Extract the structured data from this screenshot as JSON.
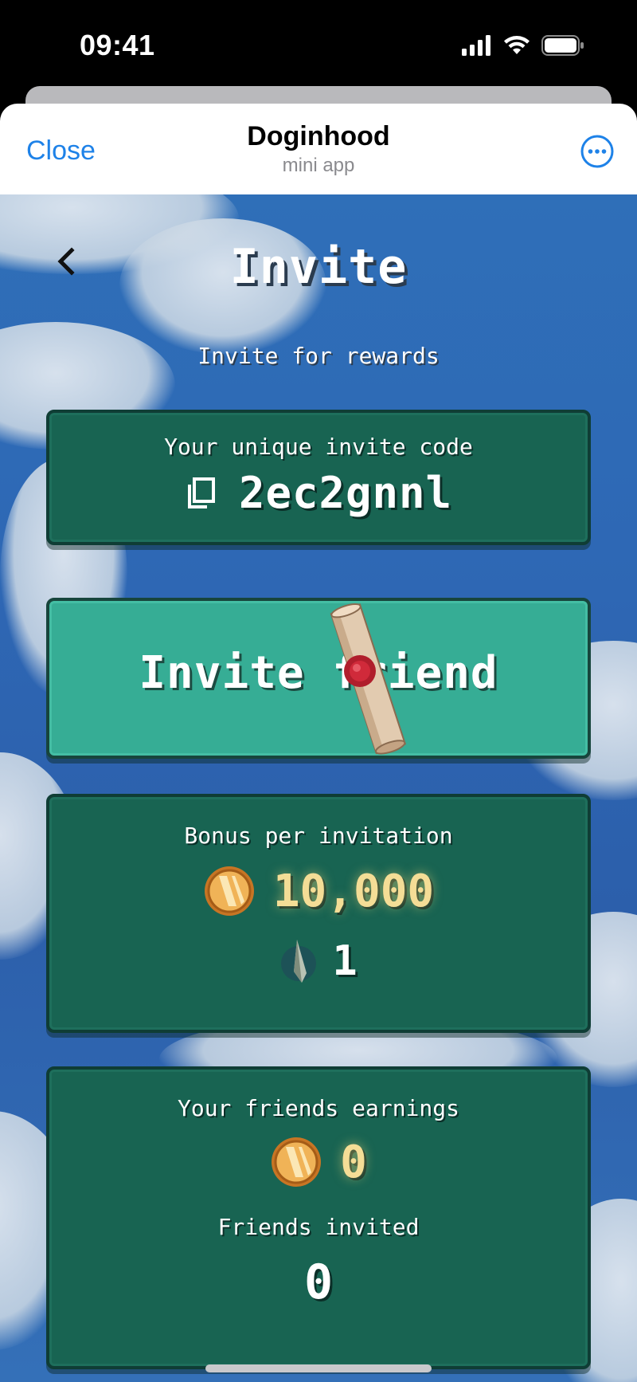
{
  "status_bar": {
    "time": "09:41"
  },
  "header": {
    "close_label": "Close",
    "title": "Doginhood",
    "subtitle": "mini app"
  },
  "page": {
    "title": "Invite",
    "subtitle": "Invite for rewards"
  },
  "invite_code": {
    "label": "Your unique invite code",
    "code": "2ec2gnnl"
  },
  "invite_button": {
    "label": "Invite friend"
  },
  "bonus": {
    "label": "Bonus per invitation",
    "coins": "10,000",
    "arrows": "1"
  },
  "friends": {
    "earnings_label": "Your friends earnings",
    "earnings": "0",
    "invited_label": "Friends invited",
    "invited_count": "0"
  },
  "colors": {
    "panel": "#186452",
    "button": "#36ad95",
    "coin_text": "#f4dd96",
    "link": "#1e82e8"
  }
}
